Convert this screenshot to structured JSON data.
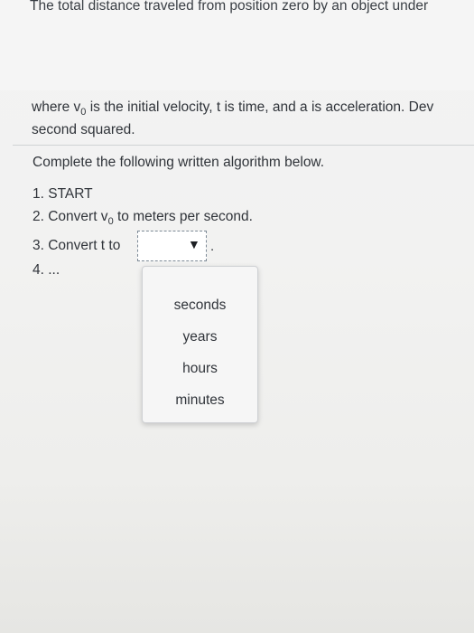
{
  "question": {
    "intro_fragment": "The total distance traveled from position zero by an object under",
    "desc_line1_a": "where v",
    "desc_line1_sub": "0",
    "desc_line1_b": " is the initial velocity, t is time, and a is acceleration. Dev",
    "desc_line2": "second squared.",
    "instructions": "Complete the following written algorithm below."
  },
  "algorithm": {
    "step1": "1. START",
    "step2_a": "2. Convert v",
    "step2_sub": "0",
    "step2_b": " to meters per second.",
    "step3": "3. Convert t to",
    "step3_after": ".",
    "step4": "4. ..."
  },
  "dropdown": {
    "selected_value": "",
    "arrow_icon": "triangle-down-icon",
    "options": [
      "seconds",
      "years",
      "hours",
      "minutes"
    ]
  }
}
